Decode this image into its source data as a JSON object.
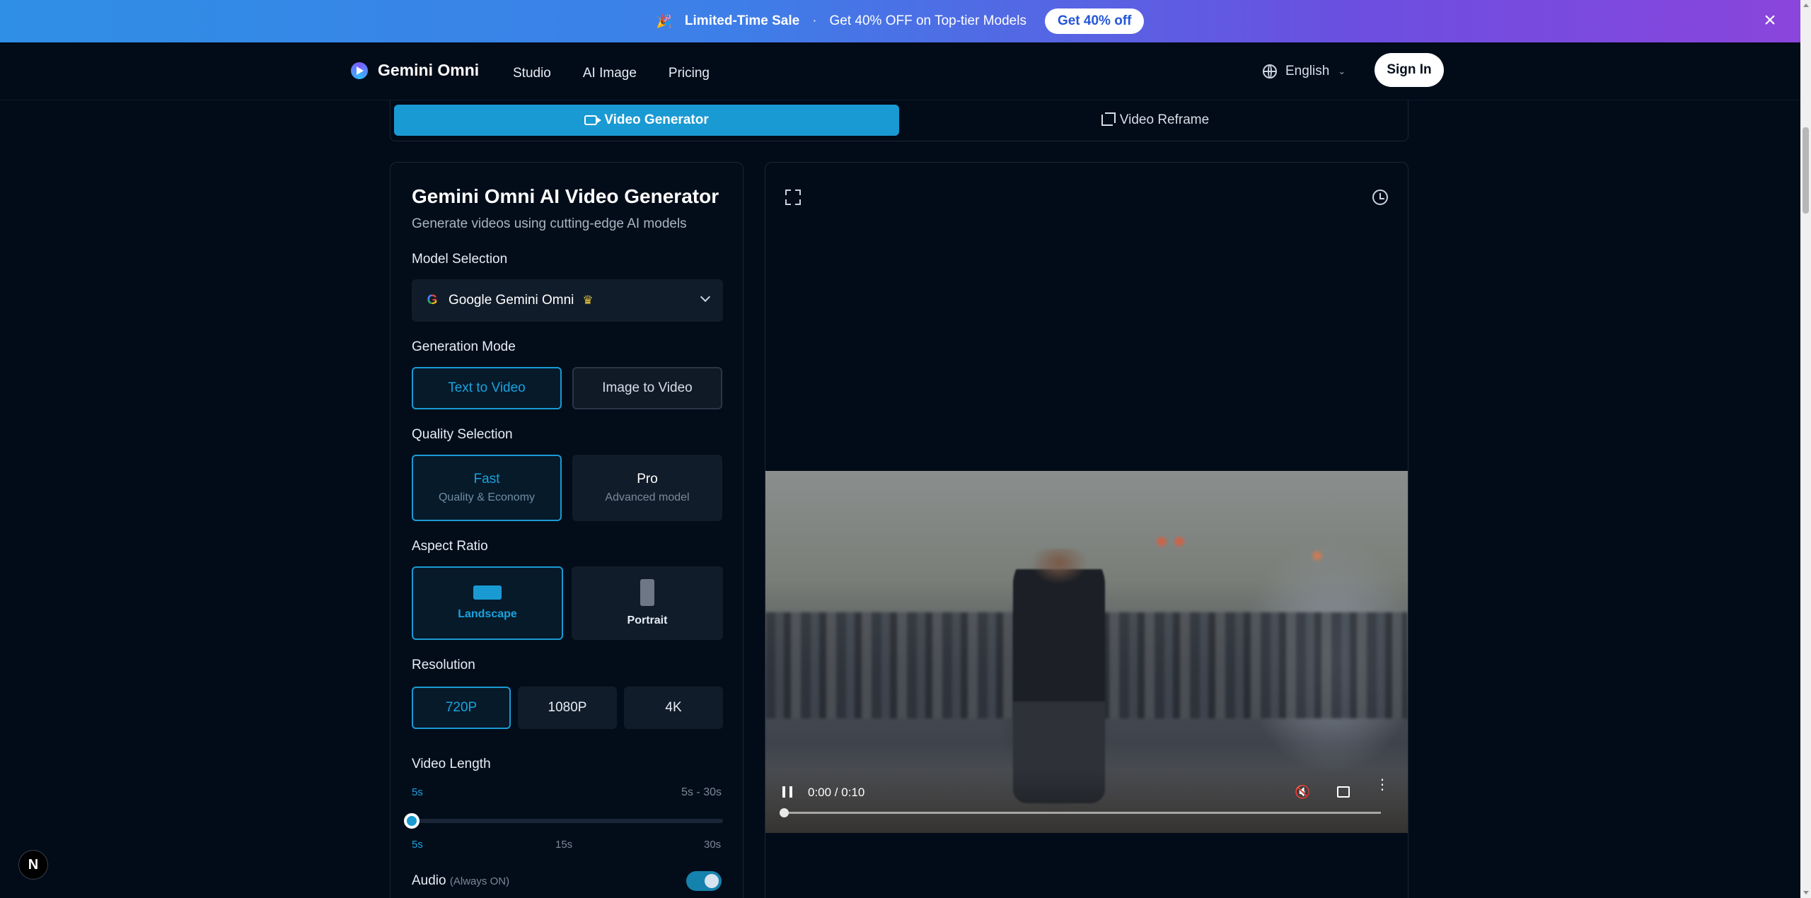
{
  "promo": {
    "emoji": "🎉",
    "headline": "Limited-Time Sale",
    "separator": "·",
    "message": "Get 40% OFF on Top-tier Models",
    "cta": "Get 40% off",
    "close_icon": "close-icon"
  },
  "header": {
    "brand": "Gemini Omni",
    "nav": [
      "Studio",
      "AI Image",
      "Pricing"
    ],
    "language": "English",
    "sign_in": "Sign In"
  },
  "tabs": [
    {
      "label": "Video Generator",
      "icon": "video-camera-icon",
      "active": true
    },
    {
      "label": "Video Reframe",
      "icon": "crop-icon",
      "active": false
    }
  ],
  "panel": {
    "title": "Gemini Omni AI Video Generator",
    "subtitle": "Generate videos using cutting-edge AI models",
    "model_label": "Model Selection",
    "model_value": "Google Gemini Omni",
    "mode_label": "Generation Mode",
    "modes": [
      "Text to Video",
      "Image to Video"
    ],
    "quality_label": "Quality Selection",
    "qualities": [
      {
        "name": "Fast",
        "desc": "Quality & Economy"
      },
      {
        "name": "Pro",
        "desc": "Advanced model"
      }
    ],
    "aspect_label": "Aspect Ratio",
    "aspects": [
      "Landscape",
      "Portrait"
    ],
    "resolution_label": "Resolution",
    "resolutions": [
      "720P",
      "1080P",
      "4K"
    ],
    "length_label": "Video Length",
    "length_value": "5s",
    "length_range": "5s - 30s",
    "length_ticks": [
      "5s",
      "15s",
      "30s"
    ],
    "length_fraction": 0,
    "audio_label": "Audio",
    "audio_note": "(Always ON)",
    "audio_on": true
  },
  "player": {
    "time": "0:00 / 0:10",
    "progress": 0
  },
  "colors": {
    "accent": "#1a9ad3",
    "background": "#020b18"
  },
  "badge": "N"
}
